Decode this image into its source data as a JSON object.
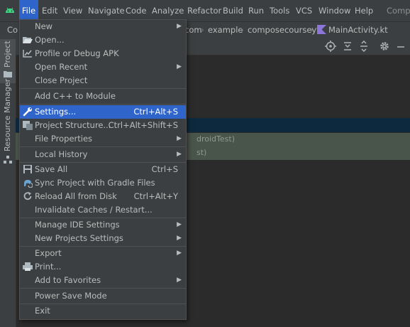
{
  "menubar": {
    "items": [
      "File",
      "Edit",
      "View",
      "Navigate",
      "Code",
      "Analyze",
      "Refactor",
      "Build",
      "Run",
      "Tools",
      "VCS",
      "Window",
      "Help"
    ],
    "title": "Compo"
  },
  "navbar": {
    "crumb1": "Co",
    "crumb2": "com",
    "crumb3": "example",
    "crumb4": "composecourseyt",
    "crumb5": "MainActivity.kt"
  },
  "toolwindow": {
    "project": "Project",
    "resource_manager": "Resource Manager"
  },
  "editor": {
    "test_row_1": "droidTest)",
    "test_row_2": "st)"
  },
  "file_menu": {
    "new": "New",
    "open": "Open...",
    "profile": "Profile or Debug APK",
    "open_recent": "Open Recent",
    "close_project": "Close Project",
    "add_cpp": "Add C++ to Module",
    "settings": "Settings...",
    "settings_sc": "Ctrl+Alt+S",
    "project_structure": "Project Structure...",
    "project_structure_sc": "Ctrl+Alt+Shift+S",
    "file_properties": "File Properties",
    "local_history": "Local History",
    "save_all": "Save All",
    "save_all_sc": "Ctrl+S",
    "sync_gradle": "Sync Project with Gradle Files",
    "reload": "Reload All from Disk",
    "reload_sc": "Ctrl+Alt+Y",
    "invalidate": "Invalidate Caches / Restart...",
    "manage_ide": "Manage IDE Settings",
    "new_projects_settings": "New Projects Settings",
    "export": "Export",
    "print": "Print...",
    "add_favorites": "Add to Favorites",
    "power_save": "Power Save Mode",
    "exit": "Exit"
  },
  "colors": {
    "accent": "#2f65ca",
    "background": "#2b2b2b",
    "panel": "#3c3f41"
  },
  "icons": [
    "android-logo-icon",
    "folder-open-icon",
    "profile-apk-icon",
    "settings-wrench-icon",
    "project-structure-icon",
    "save-icon",
    "gradle-sync-icon",
    "reload-icon",
    "print-icon",
    "target-icon",
    "collapse-icon",
    "expand-icon",
    "gear-icon",
    "minimize-icon"
  ]
}
